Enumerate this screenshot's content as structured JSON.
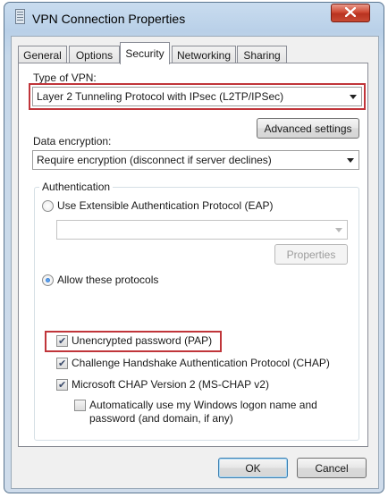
{
  "window": {
    "title": "VPN Connection Properties",
    "icon": "network-connection-icon"
  },
  "tabs": [
    {
      "label": "General",
      "active": false
    },
    {
      "label": "Options",
      "active": false
    },
    {
      "label": "Security",
      "active": true
    },
    {
      "label": "Networking",
      "active": false
    },
    {
      "label": "Sharing",
      "active": false
    }
  ],
  "security": {
    "type_of_vpn_label": "Type of VPN:",
    "type_of_vpn_value": "Layer 2 Tunneling Protocol with IPsec (L2TP/IPSec)",
    "advanced_settings_button": "Advanced settings",
    "data_encryption_label": "Data encryption:",
    "data_encryption_value": "Require encryption (disconnect if server declines)",
    "authentication": {
      "group_title": "Authentication",
      "eap_radio_label": "Use Extensible Authentication Protocol (EAP)",
      "eap_selected": false,
      "eap_combo_value": "",
      "properties_button": "Properties",
      "allow_protocols_radio_label": "Allow these protocols",
      "allow_protocols_selected": true,
      "protocols": [
        {
          "label": "Unencrypted password (PAP)",
          "checked": true
        },
        {
          "label": "Challenge Handshake Authentication Protocol (CHAP)",
          "checked": true
        },
        {
          "label": "Microsoft CHAP Version 2 (MS-CHAP v2)",
          "checked": true
        }
      ],
      "auto_logon_label_line1": "Automatically use my Windows logon name and",
      "auto_logon_label_line2": "password (and domain, if any)",
      "auto_logon_checked": false
    }
  },
  "buttons": {
    "ok": "OK",
    "cancel": "Cancel"
  },
  "colors": {
    "highlight": "#c0353a",
    "close_button": "#c84a34",
    "frame": "#b9d0e8"
  }
}
